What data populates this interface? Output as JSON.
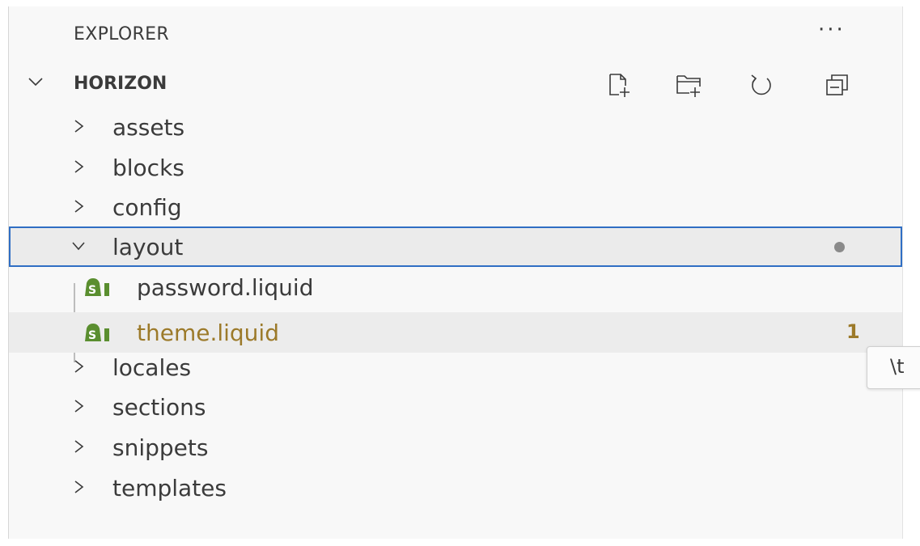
{
  "explorer": {
    "title": "EXPLORER",
    "more_actions": "···"
  },
  "workspace": {
    "name": "HORIZON",
    "actions": [
      {
        "name": "new-file",
        "icon": "new-file-icon"
      },
      {
        "name": "new-folder",
        "icon": "new-folder-icon"
      },
      {
        "name": "refresh",
        "icon": "refresh-icon"
      },
      {
        "name": "collapse-all",
        "icon": "collapse-all-icon"
      }
    ]
  },
  "tree": {
    "folders": {
      "assets": "assets",
      "blocks": "blocks",
      "config": "config",
      "layout": "layout",
      "locales": "locales",
      "sections": "sections",
      "snippets": "snippets",
      "templates": "templates"
    },
    "layout_files": {
      "password": "password.liquid",
      "theme": "theme.liquid",
      "theme_problems": "1"
    }
  },
  "tooltip": {
    "text": "\\t"
  },
  "colors": {
    "selection_border": "#2f6ec4",
    "warning": "#9c7a2a",
    "shopify_green": "#5a8e2f"
  }
}
